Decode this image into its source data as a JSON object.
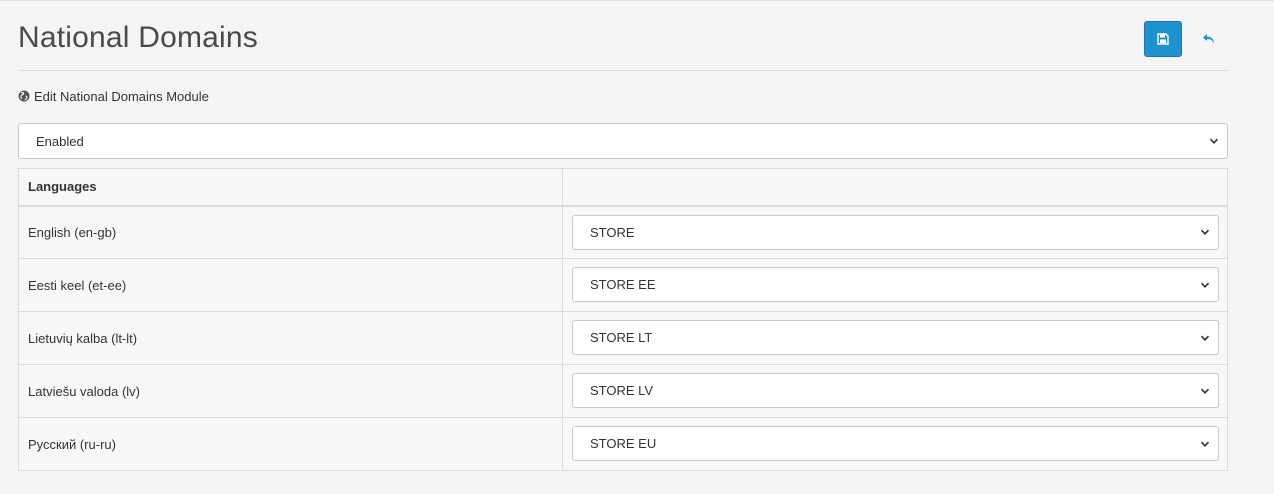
{
  "header": {
    "title": "National Domains",
    "save_icon": "floppy-disk-icon",
    "back_icon": "reply-arrow-icon",
    "accent_color": "#1e91cf"
  },
  "panel": {
    "heading": "Edit National Domains Module",
    "heading_icon": "globe-icon"
  },
  "status": {
    "selected": "Enabled"
  },
  "table": {
    "headers": [
      "Languages",
      ""
    ],
    "rows": [
      {
        "language": "English (en-gb)",
        "store": "STORE"
      },
      {
        "language": "Eesti keel (et-ee)",
        "store": "STORE EE"
      },
      {
        "language": "Lietuvių kalba (lt-lt)",
        "store": "STORE LT"
      },
      {
        "language": "Latviešu valoda (lv)",
        "store": "STORE LV"
      },
      {
        "language": "Русский (ru-ru)",
        "store": "STORE EU"
      }
    ]
  }
}
